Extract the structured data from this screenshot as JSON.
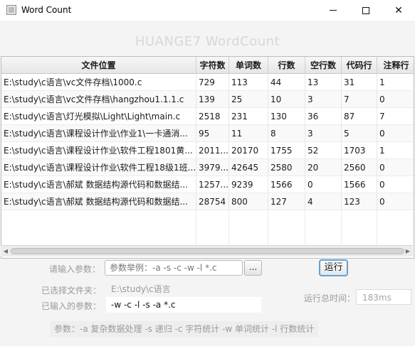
{
  "window": {
    "title": "Word Count",
    "minimize_icon": "minimize-icon",
    "maximize_icon": "maximize-icon",
    "close_icon": "close-icon"
  },
  "heading": "HUANGE7 WordCount",
  "table": {
    "columns": [
      "文件位置",
      "字符数",
      "单词数",
      "行数",
      "空行数",
      "代码行",
      "注释行"
    ],
    "rows": [
      [
        "E:\\study\\c语言\\vc文件存档\\1000.c",
        "729",
        "113",
        "44",
        "13",
        "31",
        "1"
      ],
      [
        "E:\\study\\c语言\\vc文件存档\\hangzhou1.1.1.c",
        "139",
        "25",
        "10",
        "3",
        "7",
        "0"
      ],
      [
        "E:\\study\\c语言\\灯光模拟\\Light\\Light\\main.c",
        "2518",
        "231",
        "130",
        "36",
        "87",
        "7"
      ],
      [
        "E:\\study\\c语言\\课程设计作业\\作业1\\一卡通消...",
        "95",
        "11",
        "8",
        "3",
        "5",
        "0"
      ],
      [
        "E:\\study\\c语言\\课程设计作业\\软件工程1801黄...",
        "2011...",
        "20170",
        "1755",
        "52",
        "1703",
        "1"
      ],
      [
        "E:\\study\\c语言\\课程设计作业\\软件工程18级1班...",
        "3979...",
        "42645",
        "2580",
        "20",
        "2560",
        "0"
      ],
      [
        "E:\\study\\c语言\\郝斌 数据结构源代码和数据结...",
        "1257...",
        "9239",
        "1566",
        "0",
        "1566",
        "0"
      ],
      [
        "E:\\study\\c语言\\郝斌 数据结构源代码和数据结...",
        "28754",
        "800",
        "127",
        "4",
        "123",
        "0"
      ]
    ]
  },
  "form": {
    "param_label": "请输入参数：",
    "param_placeholder": "参数举例：-a -s -c -w -l *.c",
    "browse_label": "...",
    "run_label": "运行",
    "selected_dir_label": "已选择文件夹：",
    "selected_dir_value": "E:\\study\\c语言",
    "entered_params_label": "已输入的参数：",
    "entered_params_value": "-w -c -l -s -a *.c",
    "total_time_label": "运行总时间：",
    "total_time_value": "183ms",
    "help_text": "参数：-a 复杂数据处理  -s 递归  -c 字符统计  -w  单词统计  -l 行数统计"
  }
}
